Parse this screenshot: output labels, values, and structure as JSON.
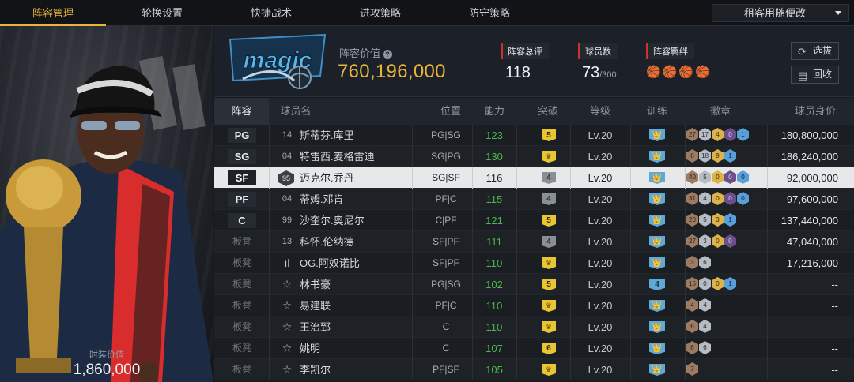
{
  "nav": {
    "tabs": [
      "阵容管理",
      "轮换设置",
      "快捷战术",
      "进攻策略",
      "防守策略"
    ],
    "active_tab": 0,
    "rental_dropdown": "租客用随便改"
  },
  "portrait": {
    "value_label": "时装价值",
    "value": "1,860,000"
  },
  "team": {
    "logo_text": "magic",
    "lineup_value_label": "阵容价值",
    "lineup_value": "760,196,000",
    "overall_label": "阵容总评",
    "overall": "118",
    "players_label": "球员数",
    "players": "73",
    "players_max": "/300",
    "bond_label": "阵容羁绊",
    "bond_icons": [
      "🏀",
      "🏀",
      "🏀",
      "🏀"
    ],
    "select_label": "选拔",
    "recycle_label": "回收"
  },
  "table": {
    "headers": [
      "阵容",
      "球员名",
      "位置",
      "能力",
      "突破",
      "等级",
      "训练",
      "徽章",
      "球员身价"
    ],
    "rows": [
      {
        "slot": "PG",
        "num": "14",
        "name": "斯蒂芬.库里",
        "pos": "PG|SG",
        "ability": "123",
        "brk": "5",
        "brk_type": "gold",
        "lvl": "Lv.20",
        "train": "👑",
        "badges": [
          [
            "27",
            "bronze"
          ],
          [
            "17",
            "silver"
          ],
          [
            "4",
            "gold"
          ],
          [
            "0",
            "purple"
          ],
          [
            "1",
            "blue"
          ]
        ],
        "salary": "180,800,000"
      },
      {
        "slot": "SG",
        "num": "04",
        "name": "特雷西.麦格雷迪",
        "pos": "SG|PG",
        "ability": "130",
        "brk": "♛",
        "brk_type": "crown",
        "lvl": "Lv.20",
        "train": "👑",
        "badges": [
          [
            "6",
            "bronze"
          ],
          [
            "18",
            "silver"
          ],
          [
            "9",
            "gold"
          ],
          [
            "1",
            "blue"
          ]
        ],
        "salary": "186,240,000"
      },
      {
        "slot": "SF",
        "num": "95",
        "name": "迈克尔.乔丹",
        "pos": "SG|SF",
        "ability": "116",
        "brk": "4",
        "brk_type": "gray",
        "lvl": "Lv.20",
        "train": "👑",
        "badges": [
          [
            "40",
            "bronze"
          ],
          [
            "5",
            "silver"
          ],
          [
            "0",
            "gold"
          ],
          [
            "0",
            "purple"
          ],
          [
            "0",
            "blue"
          ]
        ],
        "salary": "92,000,000"
      },
      {
        "slot": "PF",
        "num": "04",
        "name": "蒂姆.邓肯",
        "pos": "PF|C",
        "ability": "115",
        "brk": "4",
        "brk_type": "gray",
        "lvl": "Lv.20",
        "train": "👑",
        "badges": [
          [
            "31",
            "bronze"
          ],
          [
            "4",
            "silver"
          ],
          [
            "0",
            "gold"
          ],
          [
            "0",
            "purple"
          ],
          [
            "0",
            "blue"
          ]
        ],
        "salary": "97,600,000"
      },
      {
        "slot": "C",
        "num": "99",
        "name": "沙奎尔.奥尼尔",
        "pos": "C|PF",
        "ability": "121",
        "brk": "5",
        "brk_type": "gold",
        "lvl": "Lv.20",
        "train": "👑",
        "badges": [
          [
            "20",
            "bronze"
          ],
          [
            "5",
            "silver"
          ],
          [
            "3",
            "gold"
          ],
          [
            "1",
            "blue"
          ]
        ],
        "salary": "137,440,000"
      },
      {
        "slot": "板凳",
        "num": "13",
        "name": "科怀.伦纳德",
        "pos": "SF|PF",
        "ability": "111",
        "brk": "4",
        "brk_type": "gray",
        "lvl": "Lv.20",
        "train": "👑",
        "badges": [
          [
            "27",
            "bronze"
          ],
          [
            "3",
            "silver"
          ],
          [
            "0",
            "gold"
          ],
          [
            "0",
            "purple"
          ]
        ],
        "salary": "47,040,000"
      },
      {
        "slot": "板凳",
        "num": "ıl",
        "name": "OG.阿奴诺比",
        "pos": "SF|PF",
        "ability": "110",
        "brk": "♛",
        "brk_type": "crown",
        "lvl": "Lv.20",
        "train": "👑",
        "badges": [
          [
            "3",
            "bronze"
          ],
          [
            "6",
            "silver"
          ]
        ],
        "salary": "17,216,000"
      },
      {
        "slot": "板凳",
        "num": "☆",
        "name": "林书豪",
        "pos": "PG|SG",
        "ability": "102",
        "brk": "5",
        "brk_type": "gold",
        "lvl": "Lv.20",
        "train": "4",
        "badges": [
          [
            "15",
            "bronze"
          ],
          [
            "0",
            "silver"
          ],
          [
            "0",
            "gold"
          ],
          [
            "1",
            "blue"
          ]
        ],
        "salary": "--"
      },
      {
        "slot": "板凳",
        "num": "☆",
        "name": "易建联",
        "pos": "PF|C",
        "ability": "110",
        "brk": "♛",
        "brk_type": "crown",
        "lvl": "Lv.20",
        "train": "👑",
        "badges": [
          [
            "4",
            "bronze"
          ],
          [
            "4",
            "silver"
          ]
        ],
        "salary": "--"
      },
      {
        "slot": "板凳",
        "num": "☆",
        "name": "王治郅",
        "pos": "C",
        "ability": "110",
        "brk": "♛",
        "brk_type": "crown",
        "lvl": "Lv.20",
        "train": "👑",
        "badges": [
          [
            "6",
            "bronze"
          ],
          [
            "4",
            "silver"
          ]
        ],
        "salary": "--"
      },
      {
        "slot": "板凳",
        "num": "☆",
        "name": "姚明",
        "pos": "C",
        "ability": "107",
        "brk": "6",
        "brk_type": "gold",
        "lvl": "Lv.20",
        "train": "👑",
        "badges": [
          [
            "6",
            "bronze"
          ],
          [
            "6",
            "silver"
          ]
        ],
        "salary": "--"
      },
      {
        "slot": "板凳",
        "num": "☆",
        "name": "李凯尔",
        "pos": "PF|SF",
        "ability": "105",
        "brk": "♛",
        "brk_type": "crown",
        "lvl": "Lv.20",
        "train": "👑",
        "badges": [
          [
            "7",
            "bronze"
          ]
        ],
        "salary": "--"
      }
    ],
    "selected_row": 2
  }
}
